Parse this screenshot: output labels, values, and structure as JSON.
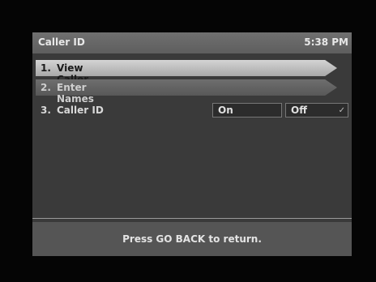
{
  "header": {
    "title": "Caller ID",
    "time": "5:38 PM"
  },
  "menu": {
    "items": [
      {
        "number": "1.",
        "label": "View Caller History",
        "selected": true
      },
      {
        "number": "2.",
        "label": "Enter Names",
        "selected": false
      },
      {
        "number": "3.",
        "label": "Caller ID",
        "selected": false
      }
    ],
    "caller_id_options": {
      "on_label": "On",
      "off_label": "Off",
      "selected": "Off",
      "check_mark": "✓"
    }
  },
  "footer": {
    "hint": "Press GO BACK to return."
  },
  "colors": {
    "selected_item": "#c4c4c4",
    "screen_background": "#3a3a3a",
    "title_bar": "#666666"
  }
}
